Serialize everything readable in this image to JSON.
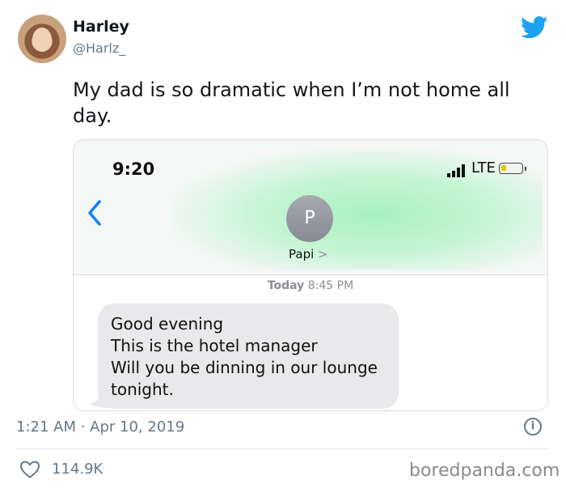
{
  "author": {
    "name": "Harley",
    "handle": "@Harlz_"
  },
  "tweet": {
    "text_line1": "My dad is so dramatic when I’m not home all",
    "text_line2": "day.",
    "timestamp": "1:21 AM · Apr 10, 2019",
    "likes": "114.9K"
  },
  "phone": {
    "status_time": "9:20",
    "network": "LTE",
    "contact_initial": "P",
    "contact_name": "Papi",
    "contact_chevron": ">",
    "thread_day": "Today",
    "thread_time": "8:45 PM",
    "message_lines": [
      "Good evening",
      "This is the hotel manager",
      "Will you be dinning in our lounge",
      "tonight."
    ]
  },
  "watermark": "boredpanda.com",
  "colors": {
    "twitter_blue": "#1da1f2",
    "ios_blue": "#147efb",
    "bubble_gray": "#e9e9eb",
    "muted_text": "#657786"
  },
  "icons": {
    "brand": "twitter-bird-icon",
    "info": "info-icon",
    "like": "heart-icon",
    "back": "chevron-left-icon",
    "signal": "signal-bars-icon",
    "battery": "battery-icon"
  }
}
